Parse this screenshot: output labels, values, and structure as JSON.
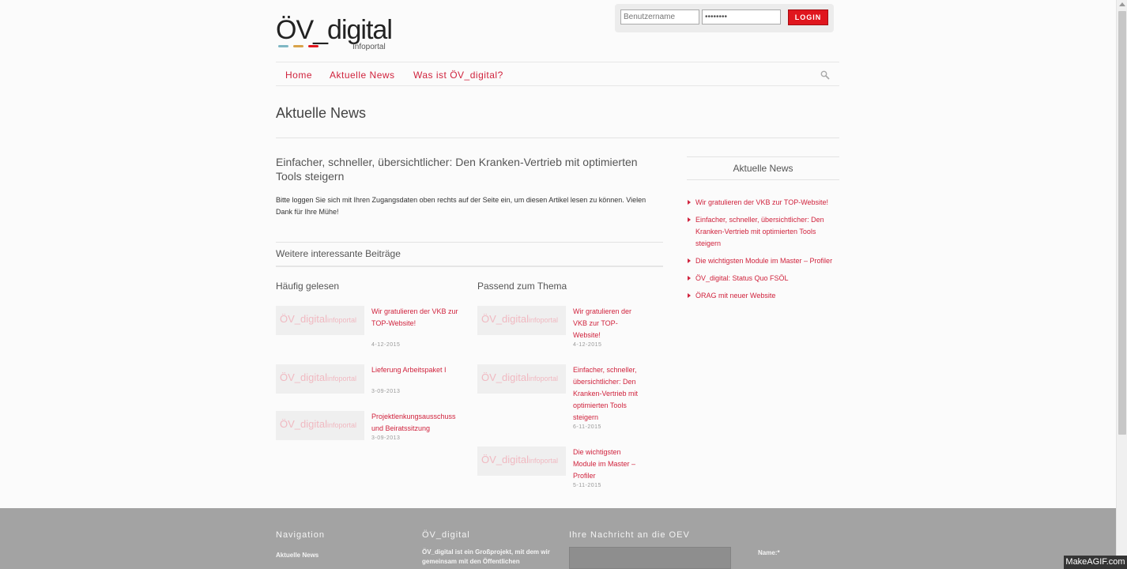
{
  "header": {
    "logo_text": "ÖV_digital",
    "logo_sub": "Infoportal",
    "logo_colors": [
      "#7fb7c4",
      "#d8a34a",
      "#e0161e"
    ]
  },
  "login": {
    "username_placeholder": "Benutzername",
    "password_value": "••••••••",
    "button_label": "LOGIN"
  },
  "nav": {
    "items": [
      "Home",
      "Aktuelle News",
      "Was ist ÖV_digital?"
    ]
  },
  "page_title": "Aktuelle News",
  "article": {
    "title": "Einfacher, schneller, übersichtlicher: Den Kranken-Vertrieb mit optimierten Tools steigern",
    "body": "Bitte loggen Sie sich mit Ihren Zugangsdaten oben rechts auf der Seite ein, um diesen Artikel lesen zu können. Vielen Dank für Ihre Mühe!"
  },
  "more": {
    "title": "Weitere interessante Beiträge",
    "thumb_text": "ÖV_digital",
    "thumb_sub": "infoportal",
    "columns": [
      {
        "title": "Häufig gelesen",
        "posts": [
          {
            "title": "Wir gratulieren der VKB zur TOP-Website!",
            "date": "4-12-2015"
          },
          {
            "title": "Lieferung Arbeitspaket I",
            "date": "3-09-2013"
          },
          {
            "title": "Projektlenkungsausschuss und Beiratssitzung",
            "date": "3-09-2013"
          }
        ]
      },
      {
        "title": "Passend zum Thema",
        "posts": [
          {
            "title": "Wir gratulieren der VKB zur TOP-Website!",
            "date": "4-12-2015"
          },
          {
            "title": "Einfacher, schneller, übersichtlicher: Den Kranken-Vertrieb mit optimierten Tools steigern",
            "date": "6-11-2015"
          },
          {
            "title": "Die wichtigsten Module im Master – Profiler",
            "date": "5-11-2015"
          }
        ]
      }
    ]
  },
  "sidebar": {
    "title": "Aktuelle News",
    "items": [
      "Wir gratulieren der VKB zur TOP-Website!",
      "Einfacher, schneller, übersichtlicher: Den Kranken-Vertrieb mit optimierten Tools steigern",
      "Die wichtigsten Module im Master – Profiler",
      "ÖV_digital: Status Quo FSÖL",
      "ÖRAG mit neuer Website"
    ]
  },
  "footer": {
    "nav_title": "Navigation",
    "nav_item": "Aktuelle News",
    "about_title": "ÖV_digital",
    "about_text": "ÖV_digital ist ein Großprojekt, mit dem wir gemeinsam mit den Öffentlichen",
    "contact_title": "Ihre Nachricht an die OEV",
    "name_label": "Name:*"
  },
  "watermark": "MakeAGIF.com"
}
